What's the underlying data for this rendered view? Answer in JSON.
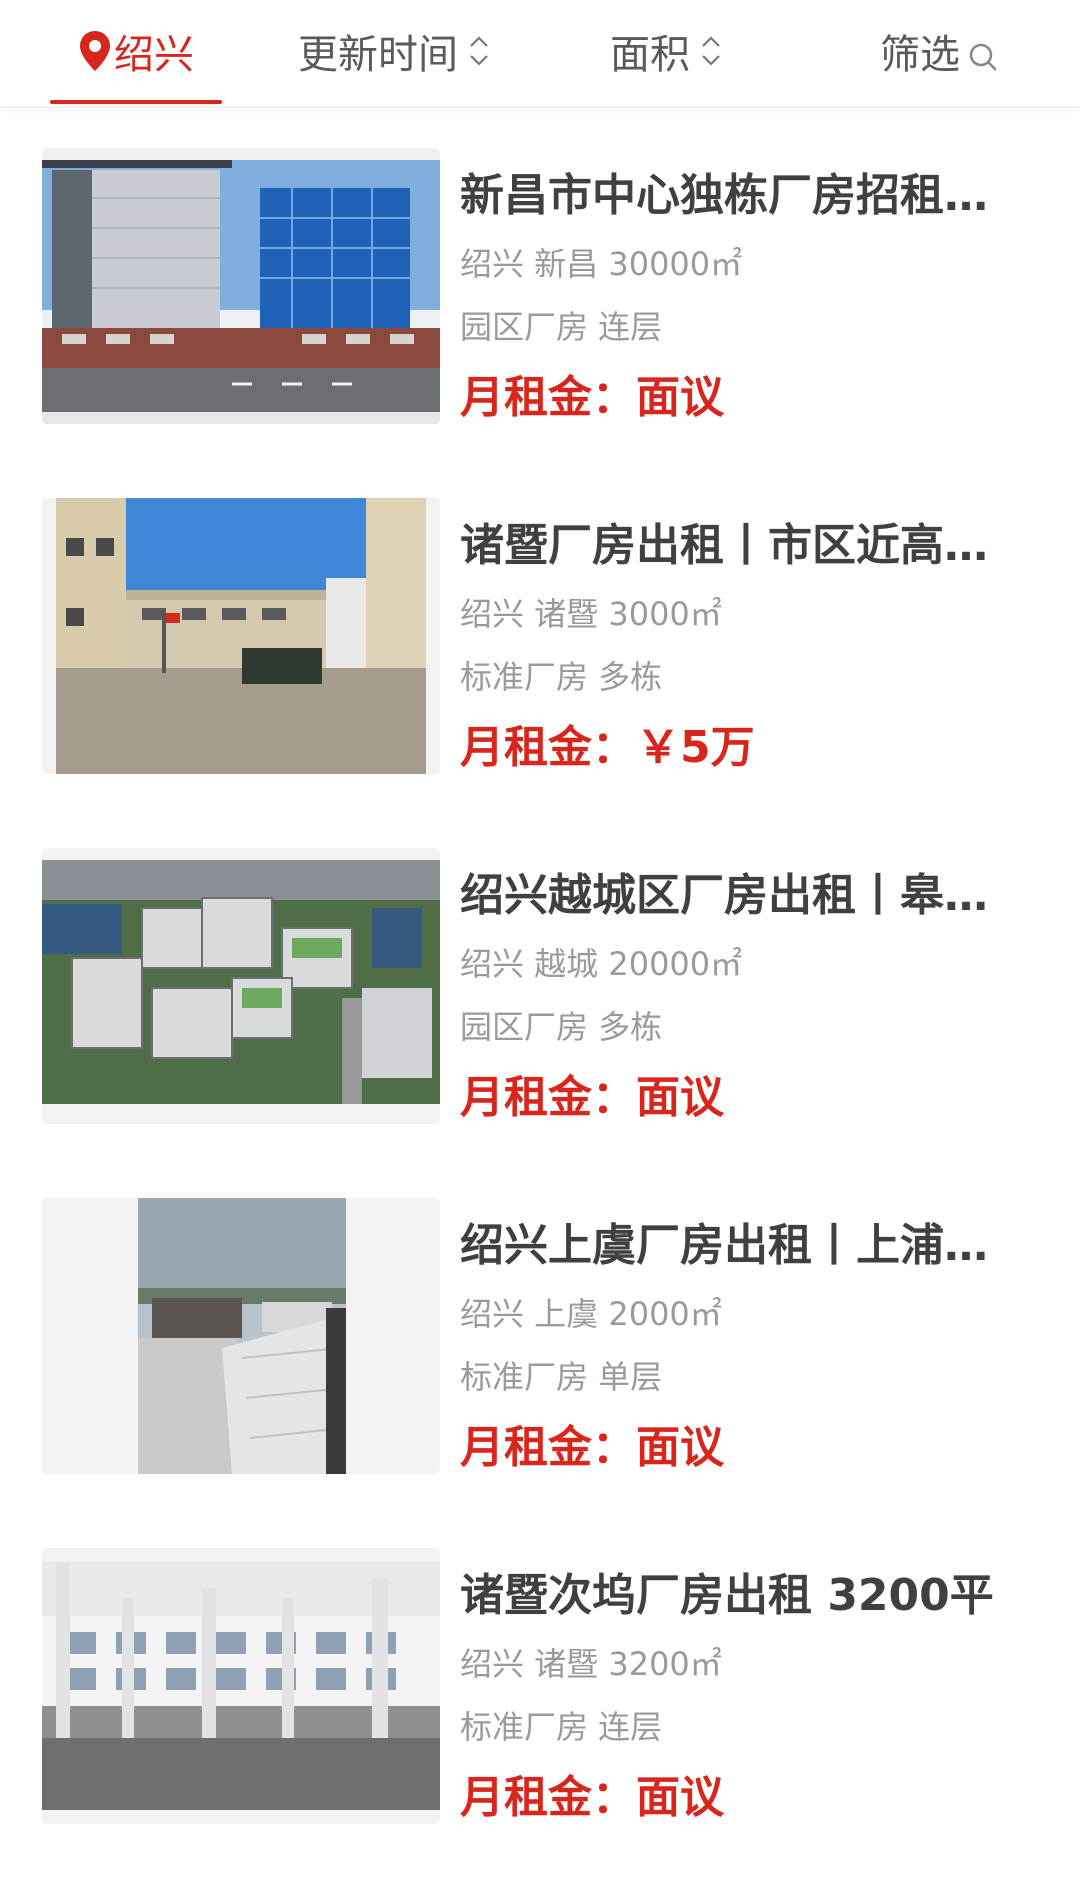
{
  "filter_bar": {
    "city": "绍兴",
    "sort_update_time": "更新时间",
    "sort_area": "面积",
    "filter": "筛选",
    "accent_color": "#d9261c"
  },
  "listings": [
    {
      "title": "新昌市中心独栋厂房招租…",
      "location": "绍兴 新昌 30000㎡",
      "type": "园区厂房 连层",
      "price_label": "月租金：",
      "price_value": "面议",
      "image": "modern glass factory building"
    },
    {
      "title": "诸暨厂房出租丨市区近高…",
      "location": "绍兴 诸暨 3000㎡",
      "type": "标准厂房 多栋",
      "price_label": "月租金：",
      "price_value": "￥5万",
      "image": "factory courtyard"
    },
    {
      "title": "绍兴越城区厂房出租丨皋…",
      "location": "绍兴 越城 20000㎡",
      "type": "园区厂房 多栋",
      "price_label": "月租金：",
      "price_value": "面议",
      "image": "aerial view of industrial park"
    },
    {
      "title": "绍兴上虞厂房出租丨上浦…",
      "location": "绍兴 上虞 2000㎡",
      "type": "标准厂房 单层",
      "price_label": "月租金：",
      "price_value": "面议",
      "image": "factory with white tent roof"
    },
    {
      "title": "诸暨次坞厂房出租 3200平",
      "location": "绍兴 诸暨 3200㎡",
      "type": "标准厂房 连层",
      "price_label": "月租金：",
      "price_value": "面议",
      "image": "empty factory interior with columns"
    }
  ]
}
